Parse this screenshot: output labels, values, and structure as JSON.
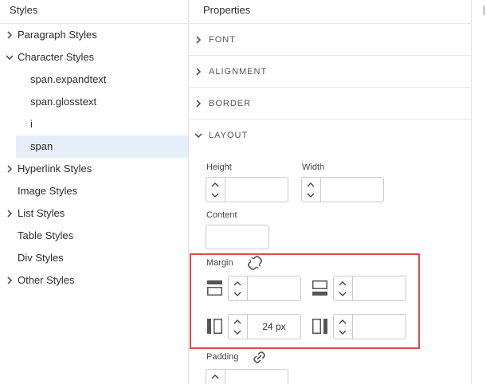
{
  "left_panel": {
    "title": "Styles",
    "items": [
      {
        "label": "Paragraph Styles",
        "expandable": true,
        "expanded": false
      },
      {
        "label": "Character Styles",
        "expandable": true,
        "expanded": true
      },
      {
        "label": "span.expandtext",
        "child": true
      },
      {
        "label": "span.glosstext",
        "child": true
      },
      {
        "label": "i",
        "child": true
      },
      {
        "label": "span",
        "child": true,
        "selected": true
      },
      {
        "label": "Hyperlink Styles",
        "expandable": true,
        "expanded": false
      },
      {
        "label": "Image Styles",
        "expandable": false
      },
      {
        "label": "List Styles",
        "expandable": true,
        "expanded": false
      },
      {
        "label": "Table Styles",
        "expandable": false
      },
      {
        "label": "Div Styles",
        "expandable": false
      },
      {
        "label": "Other Styles",
        "expandable": true,
        "expanded": false
      }
    ]
  },
  "right_panel": {
    "title": "Properties",
    "sections": [
      {
        "label": "FONT",
        "expanded": false
      },
      {
        "label": "ALIGNMENT",
        "expanded": false
      },
      {
        "label": "BORDER",
        "expanded": false
      },
      {
        "label": "LAYOUT",
        "expanded": true
      }
    ],
    "layout": {
      "height_label": "Height",
      "height_value": "",
      "width_label": "Width",
      "width_value": "",
      "content_label": "Content",
      "content_value": "",
      "margin_label": "Margin",
      "margin_link_icon": "unlink-icon",
      "margin_top_value": "",
      "margin_bottom_value": "",
      "margin_left_value": "24 px",
      "margin_right_value": "",
      "padding_label": "Padding",
      "padding_link_icon": "link-icon",
      "padding_top_value": ""
    }
  },
  "colors": {
    "selected_bg": "#e6eefa",
    "highlight_border": "#e0494b",
    "panel_border": "#e1e1e1"
  }
}
